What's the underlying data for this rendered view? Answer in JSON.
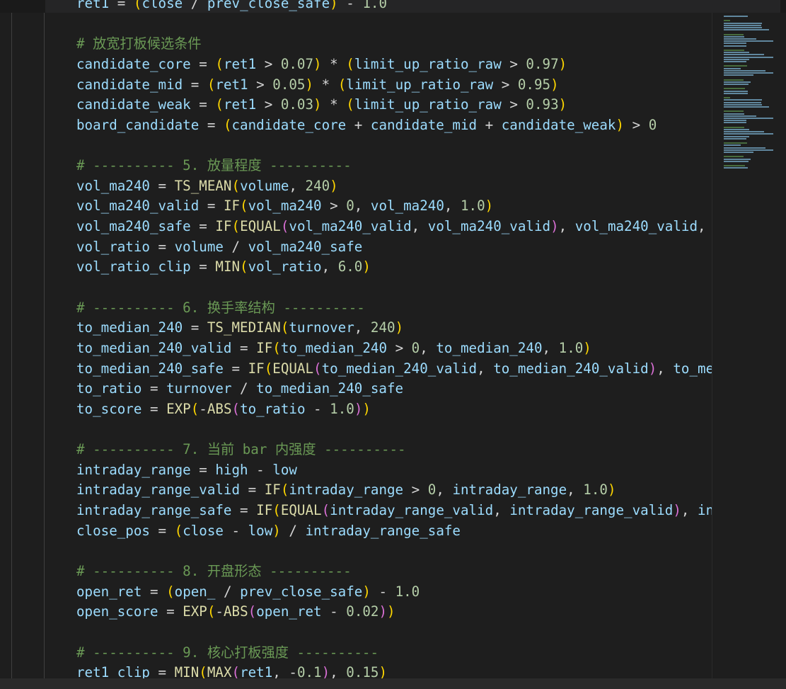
{
  "editor": {
    "language": "python",
    "visible_lines": [
      {
        "tokens": [
          [
            "v",
            "ret1"
          ],
          [
            "o",
            " = "
          ],
          [
            "p1",
            "("
          ],
          [
            "v",
            "close"
          ],
          [
            "o",
            " / "
          ],
          [
            "v",
            "prev_close_safe"
          ],
          [
            "p1",
            ")"
          ],
          [
            "o",
            " - "
          ],
          [
            "n",
            "1.0"
          ]
        ]
      },
      {
        "tokens": []
      },
      {
        "tokens": [
          [
            "c",
            "# 放宽打板候选条件"
          ]
        ]
      },
      {
        "tokens": [
          [
            "v",
            "candidate_core"
          ],
          [
            "o",
            " = "
          ],
          [
            "p1",
            "("
          ],
          [
            "v",
            "ret1"
          ],
          [
            "o",
            " > "
          ],
          [
            "n",
            "0.07"
          ],
          [
            "p1",
            ")"
          ],
          [
            "o",
            " * "
          ],
          [
            "p1",
            "("
          ],
          [
            "v",
            "limit_up_ratio_raw"
          ],
          [
            "o",
            " > "
          ],
          [
            "n",
            "0.97"
          ],
          [
            "p1",
            ")"
          ]
        ]
      },
      {
        "tokens": [
          [
            "v",
            "candidate_mid"
          ],
          [
            "o",
            " = "
          ],
          [
            "p1",
            "("
          ],
          [
            "v",
            "ret1"
          ],
          [
            "o",
            " > "
          ],
          [
            "n",
            "0.05"
          ],
          [
            "p1",
            ")"
          ],
          [
            "o",
            " * "
          ],
          [
            "p1",
            "("
          ],
          [
            "v",
            "limit_up_ratio_raw"
          ],
          [
            "o",
            " > "
          ],
          [
            "n",
            "0.95"
          ],
          [
            "p1",
            ")"
          ]
        ]
      },
      {
        "tokens": [
          [
            "v",
            "candidate_weak"
          ],
          [
            "o",
            " = "
          ],
          [
            "p1",
            "("
          ],
          [
            "v",
            "ret1"
          ],
          [
            "o",
            " > "
          ],
          [
            "n",
            "0.03"
          ],
          [
            "p1",
            ")"
          ],
          [
            "o",
            " * "
          ],
          [
            "p1",
            "("
          ],
          [
            "v",
            "limit_up_ratio_raw"
          ],
          [
            "o",
            " > "
          ],
          [
            "n",
            "0.93"
          ],
          [
            "p1",
            ")"
          ]
        ]
      },
      {
        "tokens": [
          [
            "v",
            "board_candidate"
          ],
          [
            "o",
            " = "
          ],
          [
            "p1",
            "("
          ],
          [
            "v",
            "candidate_core"
          ],
          [
            "o",
            " + "
          ],
          [
            "v",
            "candidate_mid"
          ],
          [
            "o",
            " + "
          ],
          [
            "v",
            "candidate_weak"
          ],
          [
            "p1",
            ")"
          ],
          [
            "o",
            " > "
          ],
          [
            "n",
            "0"
          ]
        ]
      },
      {
        "tokens": []
      },
      {
        "tokens": [
          [
            "c",
            "# ---------- 5. 放量程度 ----------"
          ]
        ]
      },
      {
        "tokens": [
          [
            "v",
            "vol_ma240"
          ],
          [
            "o",
            " = "
          ],
          [
            "f",
            "TS_MEAN"
          ],
          [
            "p1",
            "("
          ],
          [
            "v",
            "volume"
          ],
          [
            "o",
            ", "
          ],
          [
            "n",
            "240"
          ],
          [
            "p1",
            ")"
          ]
        ]
      },
      {
        "tokens": [
          [
            "v",
            "vol_ma240_valid"
          ],
          [
            "o",
            " = "
          ],
          [
            "f",
            "IF"
          ],
          [
            "p1",
            "("
          ],
          [
            "v",
            "vol_ma240"
          ],
          [
            "o",
            " > "
          ],
          [
            "n",
            "0"
          ],
          [
            "o",
            ", "
          ],
          [
            "v",
            "vol_ma240"
          ],
          [
            "o",
            ", "
          ],
          [
            "n",
            "1.0"
          ],
          [
            "p1",
            ")"
          ]
        ]
      },
      {
        "tokens": [
          [
            "v",
            "vol_ma240_safe"
          ],
          [
            "o",
            " = "
          ],
          [
            "f",
            "IF"
          ],
          [
            "p1",
            "("
          ],
          [
            "f",
            "EQUAL"
          ],
          [
            "p2",
            "("
          ],
          [
            "v",
            "vol_ma240_valid"
          ],
          [
            "o",
            ", "
          ],
          [
            "v",
            "vol_ma240_valid"
          ],
          [
            "p2",
            ")"
          ],
          [
            "o",
            ", "
          ],
          [
            "v",
            "vol_ma240_valid"
          ],
          [
            "o",
            ", "
          ]
        ]
      },
      {
        "tokens": [
          [
            "v",
            "vol_ratio"
          ],
          [
            "o",
            " = "
          ],
          [
            "v",
            "volume"
          ],
          [
            "o",
            " / "
          ],
          [
            "v",
            "vol_ma240_safe"
          ]
        ]
      },
      {
        "tokens": [
          [
            "v",
            "vol_ratio_clip"
          ],
          [
            "o",
            " = "
          ],
          [
            "f",
            "MIN"
          ],
          [
            "p1",
            "("
          ],
          [
            "v",
            "vol_ratio"
          ],
          [
            "o",
            ", "
          ],
          [
            "n",
            "6.0"
          ],
          [
            "p1",
            ")"
          ]
        ]
      },
      {
        "tokens": []
      },
      {
        "tokens": [
          [
            "c",
            "# ---------- 6. 换手率结构 ----------"
          ]
        ]
      },
      {
        "tokens": [
          [
            "v",
            "to_median_240"
          ],
          [
            "o",
            " = "
          ],
          [
            "f",
            "TS_MEDIAN"
          ],
          [
            "p1",
            "("
          ],
          [
            "v",
            "turnover"
          ],
          [
            "o",
            ", "
          ],
          [
            "n",
            "240"
          ],
          [
            "p1",
            ")"
          ]
        ]
      },
      {
        "tokens": [
          [
            "v",
            "to_median_240_valid"
          ],
          [
            "o",
            " = "
          ],
          [
            "f",
            "IF"
          ],
          [
            "p1",
            "("
          ],
          [
            "v",
            "to_median_240"
          ],
          [
            "o",
            " > "
          ],
          [
            "n",
            "0"
          ],
          [
            "o",
            ", "
          ],
          [
            "v",
            "to_median_240"
          ],
          [
            "o",
            ", "
          ],
          [
            "n",
            "1.0"
          ],
          [
            "p1",
            ")"
          ]
        ]
      },
      {
        "tokens": [
          [
            "v",
            "to_median_240_safe"
          ],
          [
            "o",
            " = "
          ],
          [
            "f",
            "IF"
          ],
          [
            "p1",
            "("
          ],
          [
            "f",
            "EQUAL"
          ],
          [
            "p2",
            "("
          ],
          [
            "v",
            "to_median_240_valid"
          ],
          [
            "o",
            ", "
          ],
          [
            "v",
            "to_median_240_valid"
          ],
          [
            "p2",
            ")"
          ],
          [
            "o",
            ", "
          ],
          [
            "v",
            "to_me"
          ]
        ]
      },
      {
        "tokens": [
          [
            "v",
            "to_ratio"
          ],
          [
            "o",
            " = "
          ],
          [
            "v",
            "turnover"
          ],
          [
            "o",
            " / "
          ],
          [
            "v",
            "to_median_240_safe"
          ]
        ]
      },
      {
        "tokens": [
          [
            "v",
            "to_score"
          ],
          [
            "o",
            " = "
          ],
          [
            "f",
            "EXP"
          ],
          [
            "p1",
            "("
          ],
          [
            "o",
            "-"
          ],
          [
            "f",
            "ABS"
          ],
          [
            "p2",
            "("
          ],
          [
            "v",
            "to_ratio"
          ],
          [
            "o",
            " - "
          ],
          [
            "n",
            "1.0"
          ],
          [
            "p2",
            ")"
          ],
          [
            "p1",
            ")"
          ]
        ]
      },
      {
        "tokens": []
      },
      {
        "tokens": [
          [
            "c",
            "# ---------- 7. 当前 bar 内强度 ----------"
          ]
        ]
      },
      {
        "tokens": [
          [
            "v",
            "intraday_range"
          ],
          [
            "o",
            " = "
          ],
          [
            "v",
            "high"
          ],
          [
            "o",
            " - "
          ],
          [
            "v",
            "low"
          ]
        ]
      },
      {
        "tokens": [
          [
            "v",
            "intraday_range_valid"
          ],
          [
            "o",
            " = "
          ],
          [
            "f",
            "IF"
          ],
          [
            "p1",
            "("
          ],
          [
            "v",
            "intraday_range"
          ],
          [
            "o",
            " > "
          ],
          [
            "n",
            "0"
          ],
          [
            "o",
            ", "
          ],
          [
            "v",
            "intraday_range"
          ],
          [
            "o",
            ", "
          ],
          [
            "n",
            "1.0"
          ],
          [
            "p1",
            ")"
          ]
        ]
      },
      {
        "tokens": [
          [
            "v",
            "intraday_range_safe"
          ],
          [
            "o",
            " = "
          ],
          [
            "f",
            "IF"
          ],
          [
            "p1",
            "("
          ],
          [
            "f",
            "EQUAL"
          ],
          [
            "p2",
            "("
          ],
          [
            "v",
            "intraday_range_valid"
          ],
          [
            "o",
            ", "
          ],
          [
            "v",
            "intraday_range_valid"
          ],
          [
            "p2",
            ")"
          ],
          [
            "o",
            ", "
          ],
          [
            "v",
            "in"
          ]
        ]
      },
      {
        "tokens": [
          [
            "v",
            "close_pos"
          ],
          [
            "o",
            " = "
          ],
          [
            "p1",
            "("
          ],
          [
            "v",
            "close"
          ],
          [
            "o",
            " - "
          ],
          [
            "v",
            "low"
          ],
          [
            "p1",
            ")"
          ],
          [
            "o",
            " / "
          ],
          [
            "v",
            "intraday_range_safe"
          ]
        ]
      },
      {
        "tokens": []
      },
      {
        "tokens": [
          [
            "c",
            "# ---------- 8. 开盘形态 ----------"
          ]
        ]
      },
      {
        "tokens": [
          [
            "v",
            "open_ret"
          ],
          [
            "o",
            " = "
          ],
          [
            "p1",
            "("
          ],
          [
            "v",
            "open_"
          ],
          [
            "o",
            " / "
          ],
          [
            "v",
            "prev_close_safe"
          ],
          [
            "p1",
            ")"
          ],
          [
            "o",
            " - "
          ],
          [
            "n",
            "1.0"
          ]
        ]
      },
      {
        "tokens": [
          [
            "v",
            "open_score"
          ],
          [
            "o",
            " = "
          ],
          [
            "f",
            "EXP"
          ],
          [
            "p1",
            "("
          ],
          [
            "o",
            "-"
          ],
          [
            "f",
            "ABS"
          ],
          [
            "p2",
            "("
          ],
          [
            "v",
            "open_ret"
          ],
          [
            "o",
            " - "
          ],
          [
            "n",
            "0.02"
          ],
          [
            "p2",
            ")"
          ],
          [
            "p1",
            ")"
          ]
        ]
      },
      {
        "tokens": []
      },
      {
        "tokens": [
          [
            "c",
            "# ---------- 9. 核心打板强度 ----------"
          ]
        ]
      },
      {
        "tokens": [
          [
            "v",
            "ret1_clip"
          ],
          [
            "o",
            " = "
          ],
          [
            "f",
            "MIN"
          ],
          [
            "p1",
            "("
          ],
          [
            "f",
            "MAX"
          ],
          [
            "p2",
            "("
          ],
          [
            "v",
            "ret1"
          ],
          [
            "o",
            ", "
          ],
          [
            "o",
            "-"
          ],
          [
            "n",
            "0.1"
          ],
          [
            "p2",
            ")"
          ],
          [
            "o",
            ", "
          ],
          [
            "n",
            "0.15"
          ],
          [
            "p1",
            ")"
          ]
        ]
      }
    ]
  },
  "colors": {
    "background": "#1e1e1e",
    "comment": "#6a9955",
    "variable": "#9cdcfe",
    "number": "#b5cea8",
    "function": "#dcdcaa",
    "bracket_1": "#ffd700",
    "bracket_2": "#da70d6"
  }
}
